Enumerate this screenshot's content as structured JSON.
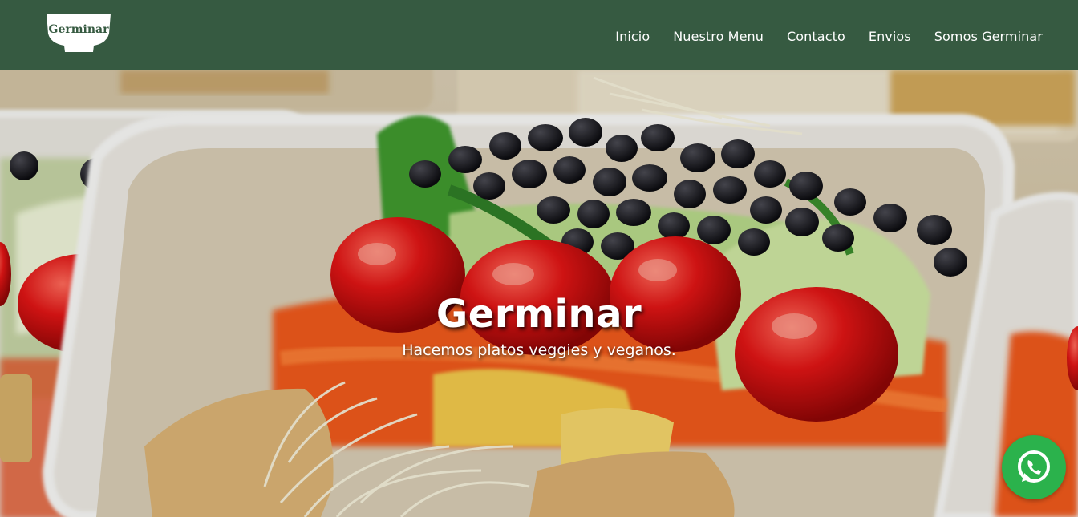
{
  "brand": {
    "logo_text": "Germinar"
  },
  "nav": {
    "items": [
      {
        "label": "Inicio"
      },
      {
        "label": "Nuestro Menu"
      },
      {
        "label": "Contacto"
      },
      {
        "label": "Envios"
      },
      {
        "label": "Somos Germinar"
      }
    ]
  },
  "hero": {
    "title": "Germinar",
    "subtitle": "Hacemos platos veggies y veganos."
  },
  "colors": {
    "navbar": "#365a41",
    "whatsapp": "#2bb24c"
  },
  "floating": {
    "icon": "whatsapp-icon"
  }
}
